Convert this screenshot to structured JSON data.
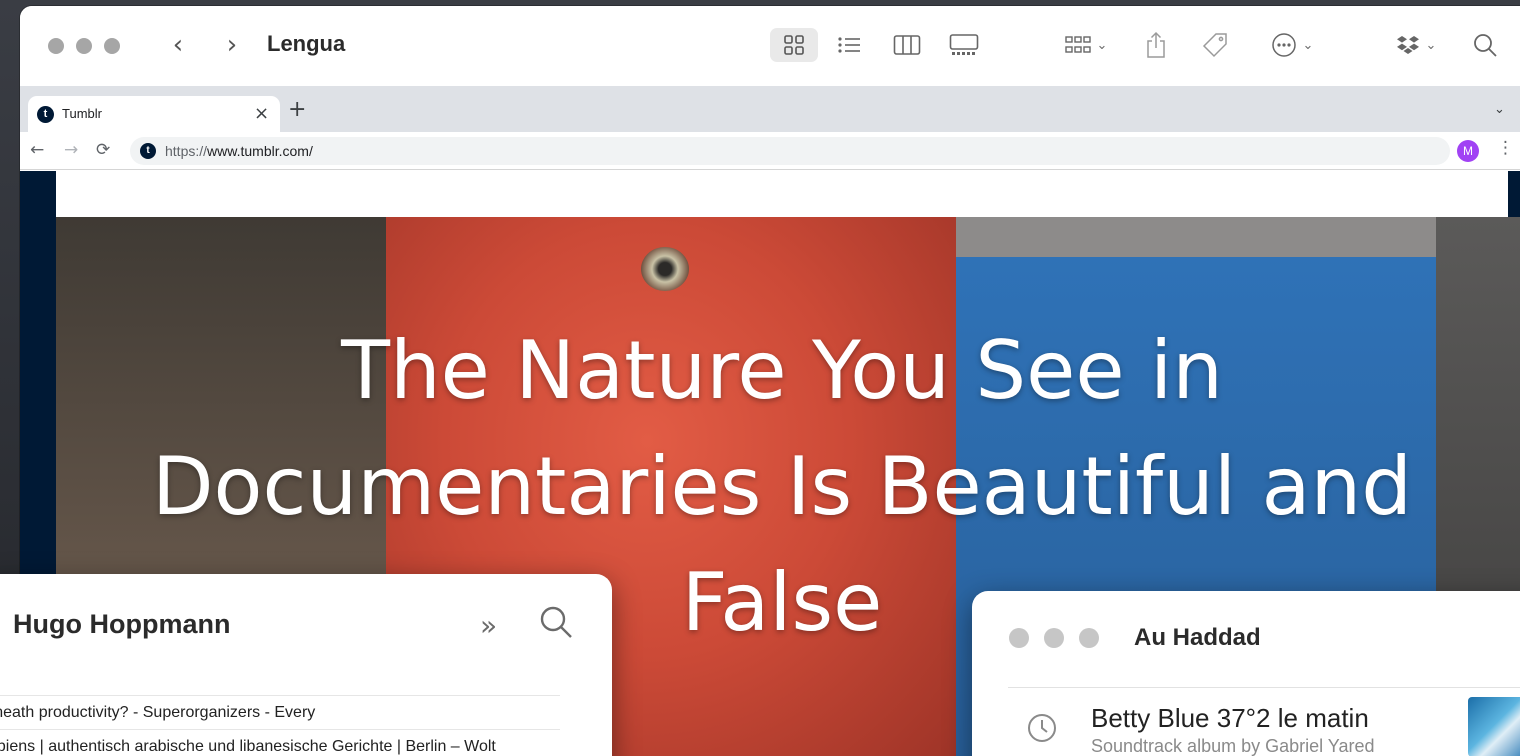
{
  "finder": {
    "title": "Lengua",
    "toolbar": {
      "view_icons": [
        "icon-view-icon",
        "list-view-icon",
        "column-view-icon",
        "gallery-view-icon"
      ],
      "group_icon": "group-by-icon",
      "share_icon": "share-icon",
      "tag_icon": "tag-icon",
      "more_icon": "more-actions-icon",
      "dropbox_icon": "dropbox-icon",
      "search_icon": "search-icon"
    }
  },
  "browser": {
    "tab": {
      "title": "Tumblr",
      "favicon": "t"
    },
    "new_tab": "+",
    "close_tab": "×",
    "url_scheme": "https://",
    "url_host": "www.tumblr.com/",
    "profile_initial": "M"
  },
  "hero": {
    "title": "The Nature You See in Documentaries Is Beautiful and False"
  },
  "notes_window": {
    "title": "Hugo Hoppmann",
    "rows": [
      "erneath productivity? - Superorganizers - Every",
      "sapiens | authentisch arabische und libanesische Gerichte | Berlin – Wolt"
    ]
  },
  "music_window": {
    "title": "Au Haddad",
    "song": "Betty Blue 37°2 le matin",
    "subtitle": "Soundtrack album by Gabriel Yared"
  },
  "colors": {
    "tumblr_navy": "#001935",
    "profile_purple": "#a142f4",
    "hero_red": "#d85440",
    "hero_blue": "#2c68a8"
  }
}
